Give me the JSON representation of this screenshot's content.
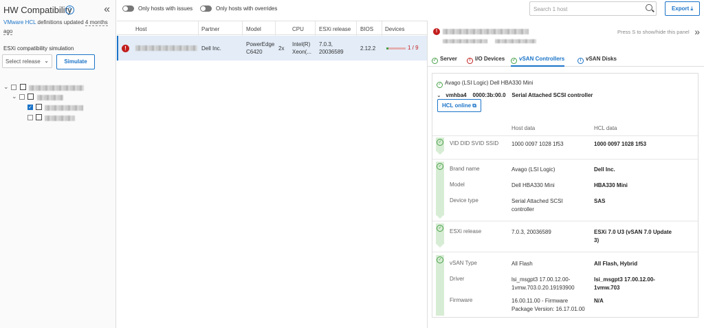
{
  "header": {
    "title": "HW Compatibility",
    "hcl_link": "VMware HCL",
    "hcl_updated_text": " definitions updated ",
    "hcl_updated_age_1": "4 months",
    "hcl_updated_age_2": "ago",
    "simulation_label": "ESXi compatibility simulation",
    "release_placeholder": "Select release",
    "simulate_label": "Simulate"
  },
  "toolbar": {
    "toggle_issues_label": "Only hosts with issues",
    "toggle_overrides_label": "Only hosts with overrides",
    "search_placeholder": "Search 1 host",
    "export_label": "Export"
  },
  "table": {
    "columns": [
      "Host",
      "Partner",
      "Model",
      "CPU",
      "ESXi release",
      "BIOS",
      "Devices"
    ],
    "rows": [
      {
        "partner": "Dell Inc.",
        "model_1": "PowerEdge",
        "model_2": "C6420",
        "cpu_count": "2x",
        "cpu_1": "Intel(R)",
        "cpu_2": "Xeon(...",
        "esxi_1": "7.0.3,",
        "esxi_2": "20036589",
        "bios": "2.12.2",
        "devices_ok": 1,
        "devices_total": 9,
        "devices_label": "1 / 9"
      }
    ]
  },
  "panel": {
    "hint": "Press S to show/hide this panel",
    "tabs": [
      "Server",
      "I/O Devices",
      "vSAN Controllers",
      "vSAN Disks"
    ],
    "active_tab": "vSAN Controllers",
    "controller_title": "Avago (LSI Logic) Dell HBA330 Mini",
    "controller_adapter": "vmhba4",
    "controller_pci": "0000:3b:00.0",
    "controller_type": "Serial Attached SCSI controller",
    "hcl_online_label": "HCL online",
    "col_host": "Host data",
    "col_hcl": "HCL data",
    "rows": {
      "vid": {
        "label": "VID DID SVID SSID",
        "host": "1000 0097 1028 1f53",
        "hcl": "1000 0097 1028 1f53"
      },
      "brand": {
        "label": "Brand name",
        "host": "Avago (LSI Logic)",
        "hcl": "Dell Inc."
      },
      "model": {
        "label": "Model",
        "host": "Dell HBA330 Mini",
        "hcl": "HBA330 Mini"
      },
      "device_type": {
        "label": "Device type",
        "host_1": "Serial Attached SCSI",
        "host_2": "controller",
        "hcl": "SAS"
      },
      "esxi": {
        "label": "ESXi release",
        "host": "7.0.3, 20036589",
        "hcl_1": "ESXi 7.0 U3 (vSAN 7.0 Update",
        "hcl_2": "3)"
      },
      "vsan_type": {
        "label": "vSAN Type",
        "host": "All Flash",
        "hcl": "All Flash, Hybrid"
      },
      "driver": {
        "label": "Driver",
        "host_1": "lsi_msgpt3 17.00.12.00-",
        "host_2": "1vmw.703.0.20.19193900",
        "hcl_1": "lsi_msgpt3 17.00.12.00-",
        "hcl_2": "1vmw.703"
      },
      "firmware": {
        "label": "Firmware",
        "host_1": "16.00.11.00 - Firmware",
        "host_2": "Package Version: 16.17.01.00",
        "hcl": "N/A"
      }
    }
  },
  "colors": {
    "accent": "#1a73c8",
    "error": "#c21d1d",
    "ok": "#47a047",
    "selected_row": "#e3ecf7"
  },
  "icons": [
    "help-icon",
    "collapse-left-icon",
    "chevron-down-icon",
    "search-icon",
    "error-icon",
    "check-circle-icon",
    "info-icon",
    "external-link-icon",
    "hide-panel-icon"
  ]
}
